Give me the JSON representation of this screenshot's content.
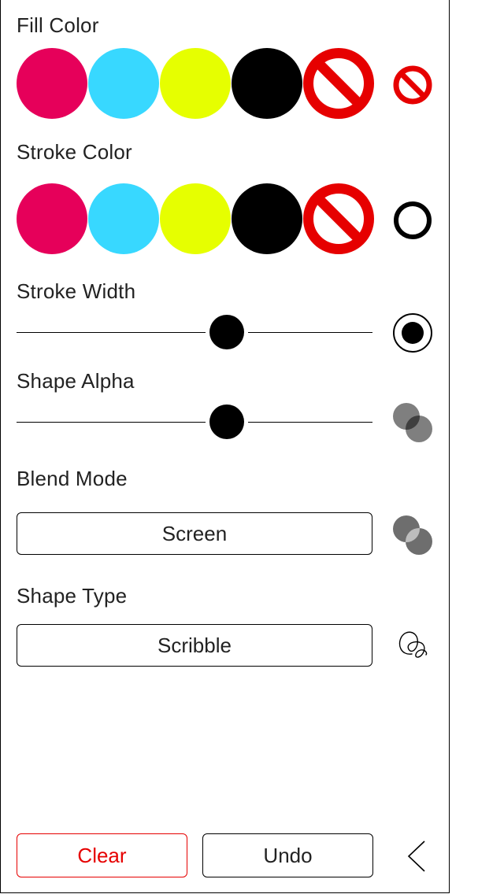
{
  "fill_color": {
    "label": "Fill Color",
    "swatches": [
      {
        "name": "magenta",
        "color": "#e6005a"
      },
      {
        "name": "cyan",
        "color": "#38d8ff"
      },
      {
        "name": "yellow",
        "color": "#e6ff00"
      },
      {
        "name": "black",
        "color": "#000000"
      },
      {
        "name": "none",
        "color": "#e60000"
      }
    ],
    "current_icon": "no-fill-icon"
  },
  "stroke_color": {
    "label": "Stroke Color",
    "swatches": [
      {
        "name": "magenta",
        "color": "#e6005a"
      },
      {
        "name": "cyan",
        "color": "#38d8ff"
      },
      {
        "name": "yellow",
        "color": "#e6ff00"
      },
      {
        "name": "black",
        "color": "#000000"
      },
      {
        "name": "none",
        "color": "#e60000"
      }
    ],
    "current_icon": "stroke-ring-icon"
  },
  "stroke_width": {
    "label": "Stroke Width",
    "value": 0.5,
    "preview_icon": "stroke-width-icon"
  },
  "shape_alpha": {
    "label": "Shape Alpha",
    "value": 0.5,
    "preview_icon": "alpha-circles-icon"
  },
  "blend_mode": {
    "label": "Blend Mode",
    "value": "Screen",
    "preview_icon": "blend-circles-icon"
  },
  "shape_type": {
    "label": "Shape Type",
    "value": "Scribble",
    "preview_icon": "scribble-icon"
  },
  "actions": {
    "clear_label": "Clear",
    "undo_label": "Undo",
    "back_icon": "chevron-left-icon"
  },
  "colors": {
    "clear_red": "#e60000"
  }
}
